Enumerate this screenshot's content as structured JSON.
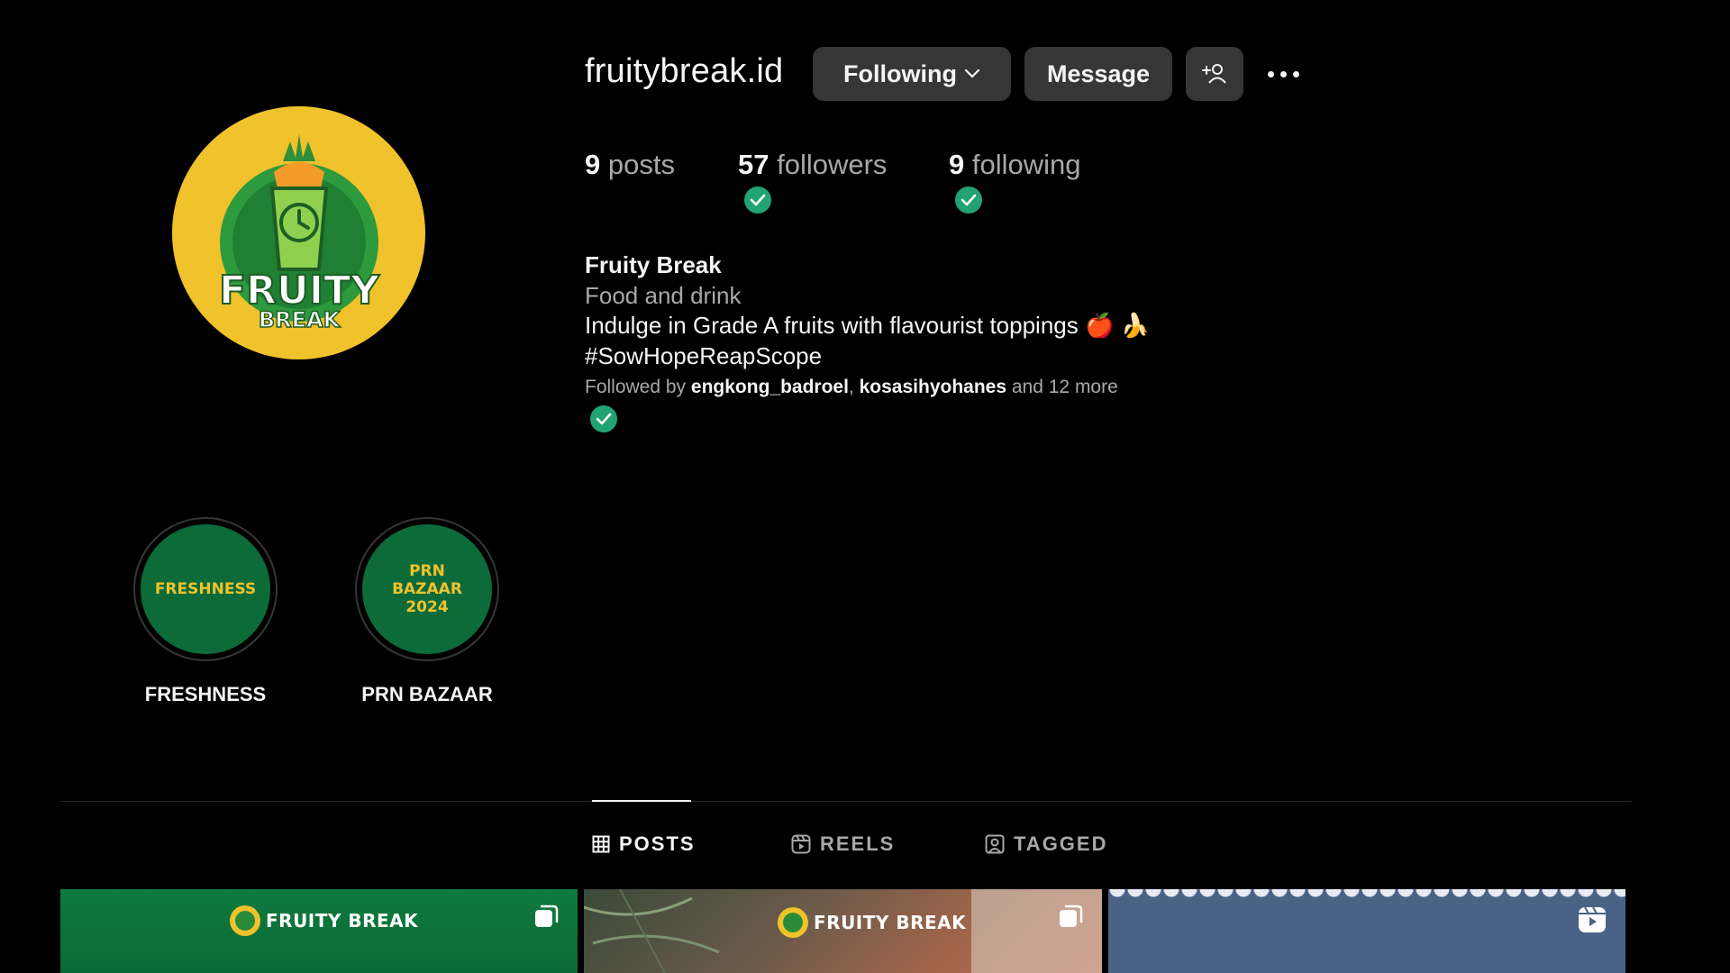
{
  "profile": {
    "username": "fruitybreak.id",
    "avatar_text_main": "FRUITY",
    "avatar_text_sub": "BREAK"
  },
  "actions": {
    "following_label": "Following",
    "message_label": "Message"
  },
  "stats": {
    "posts_count": "9",
    "posts_label": "posts",
    "followers_count": "57",
    "followers_label": "followers",
    "following_count": "9",
    "following_label": "following"
  },
  "bio": {
    "name": "Fruity Break",
    "category": "Food and drink",
    "text": "Indulge in Grade A fruits with flavourist toppings 🍎 🍌",
    "hashtag": "#SowHopeReapScope",
    "followed_by_prefix": "Followed by",
    "followed_by_user1": "engkong_badroel",
    "followed_by_sep": ",",
    "followed_by_user2": "kosasihyohanes",
    "followed_by_suffix": "and 12 more"
  },
  "highlights": [
    {
      "label": "FRESHNESS",
      "cover_lines": [
        "FRESHNESS"
      ]
    },
    {
      "label": "PRN BAZAAR",
      "cover_lines": [
        "PRN",
        "BAZAAR",
        "2024"
      ]
    }
  ],
  "tabs": {
    "posts": "POSTS",
    "reels": "REELS",
    "tagged": "TAGGED",
    "active": "POSTS"
  },
  "grid": {
    "post1_brand": "FRUITY BREAK",
    "post2_brand": "FRUITY BREAK"
  },
  "colors": {
    "background": "#000000",
    "button_bg": "#363636",
    "verified_check": "#21a374",
    "brand_yellow": "#f0c22b",
    "brand_green": "#0d6b3a"
  }
}
